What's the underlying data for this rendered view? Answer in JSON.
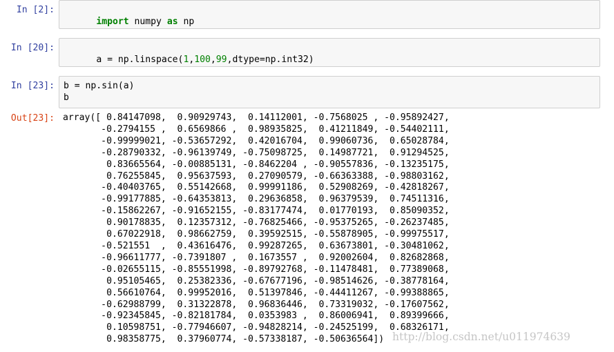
{
  "cells": [
    {
      "prompt": "In [2]:",
      "code_parts": [
        {
          "text": "import",
          "kind": "kw"
        },
        {
          "text": " numpy ",
          "kind": "plain"
        },
        {
          "text": "as",
          "kind": "kw"
        },
        {
          "text": " np",
          "kind": "plain"
        }
      ]
    },
    {
      "prompt": "In [20]:",
      "code_parts": [
        {
          "text": "a = np.linspace(",
          "kind": "plain"
        },
        {
          "text": "1",
          "kind": "num"
        },
        {
          "text": ",",
          "kind": "plain"
        },
        {
          "text": "100",
          "kind": "num"
        },
        {
          "text": ",",
          "kind": "plain"
        },
        {
          "text": "99",
          "kind": "num"
        },
        {
          "text": ",dtype=np.int32)",
          "kind": "plain"
        }
      ]
    },
    {
      "prompt": "In [23]:",
      "code_lines": [
        "b = np.sin(a)",
        "b"
      ]
    }
  ],
  "output": {
    "prompt": "Out[23]:",
    "lines": [
      "array([ 0.84147098,  0.90929743,  0.14112001, -0.7568025 , -0.95892427,",
      "       -0.2794155 ,  0.6569866 ,  0.98935825,  0.41211849, -0.54402111,",
      "       -0.99999021, -0.53657292,  0.42016704,  0.99060736,  0.65028784,",
      "       -0.28790332, -0.96139749, -0.75098725,  0.14987721,  0.91294525,",
      "        0.83665564, -0.00885131, -0.8462204 , -0.90557836, -0.13235175,",
      "        0.76255845,  0.95637593,  0.27090579, -0.66363388, -0.98803162,",
      "       -0.40403765,  0.55142668,  0.99991186,  0.52908269, -0.42818267,",
      "       -0.99177885, -0.64353813,  0.29636858,  0.96379539,  0.74511316,",
      "       -0.15862267, -0.91652155, -0.83177474,  0.01770193,  0.85090352,",
      "        0.90178835,  0.12357312, -0.76825466, -0.95375265, -0.26237485,",
      "        0.67022918,  0.98662759,  0.39592515, -0.55878905, -0.99975517,",
      "       -0.521551  ,  0.43616476,  0.99287265,  0.63673801, -0.30481062,",
      "       -0.96611777, -0.7391807 ,  0.1673557 ,  0.92002604,  0.82682868,",
      "       -0.02655115, -0.85551998, -0.89792768, -0.11478481,  0.77389068,",
      "        0.95105465,  0.25382336, -0.67677196, -0.98514626, -0.38778164,",
      "        0.56610764,  0.99952016,  0.51397846, -0.44411267, -0.99388865,",
      "       -0.62988799,  0.31322878,  0.96836446,  0.73319032, -0.17607562,",
      "       -0.92345845, -0.82181784,  0.0353983 ,  0.86006941,  0.89399666,",
      "        0.10598751, -0.77946607, -0.94828214, -0.24525199,  0.68326171,",
      "        0.98358775,  0.37960774, -0.57338187, -0.50636564])"
    ]
  },
  "watermark": "http://blog.csdn.net/u011974639"
}
